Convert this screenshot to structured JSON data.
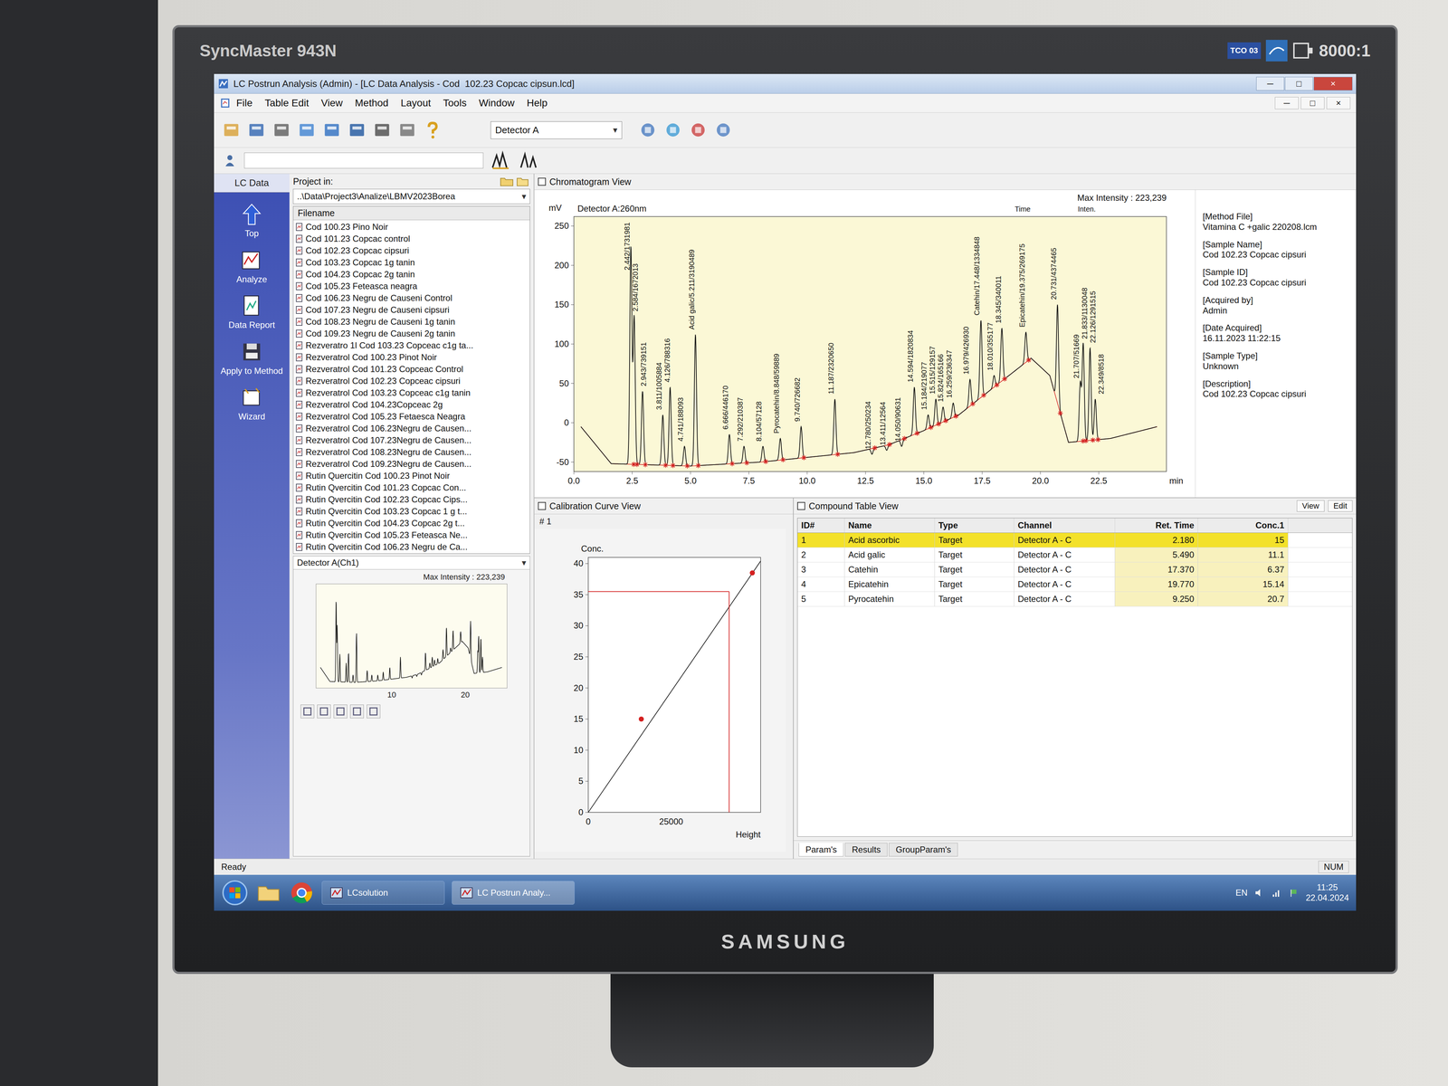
{
  "monitor": {
    "model": "SyncMaster 943N",
    "contrast": "8000:1",
    "badge": "TCO 03",
    "brand": "SAMSUNG"
  },
  "window": {
    "title": "LC Postrun Analysis (Admin) - [LC Data Analysis - Cod  102.23 Copcac cipsun.lcd]",
    "buttons": [
      "─",
      "□",
      "×"
    ]
  },
  "menu": [
    "File",
    "Table Edit",
    "View",
    "Method",
    "Layout",
    "Tools",
    "Window",
    "Help"
  ],
  "mdi_buttons": [
    "─",
    "□",
    "×"
  ],
  "toolbar": {
    "detector": "Detector A",
    "dropdown_arrow": "▾",
    "field_value": ""
  },
  "nav": {
    "header": "LC Data",
    "items": [
      {
        "label": "Top"
      },
      {
        "label": "Analyze"
      },
      {
        "label": "Data Report"
      },
      {
        "label": "Apply to Method"
      },
      {
        "label": "Wizard"
      }
    ]
  },
  "project": {
    "label": "Project in:",
    "path": "..\\Data\\Project3\\Analize\\LBMV2023Borea",
    "column": "Filename",
    "files": [
      "Cod 100.23 Pino Noir",
      "Cod 101.23 Copcac control",
      "Cod 102.23 Copcac cipsuri",
      "Cod 103.23 Copcac 1g tanin",
      "Cod 104.23 Copcac 2g tanin",
      "Cod 105.23 Feteasca neagra",
      "Cod 106.23 Negru de Causeni Control",
      "Cod 107.23 Negru de Causeni cipsuri",
      "Cod 108.23 Negru de Causeni 1g tanin",
      "Cod 109.23 Negru de Causeni 2g tanin",
      "Rezveratro 1l Cod 103.23 Copceac c1g ta...",
      "Rezveratrol Cod 100.23 Pinot Noir",
      "Rezveratrol Cod 101.23 Copceac Control",
      "Rezveratrol Cod 102.23 Copceac cipsuri",
      "Rezveratrol Cod 103.23 Copceac c1g tanin",
      "Rezveratrol Cod 104.23Copceac 2g",
      "Rezveratrol Cod 105.23 Fetaesca Neagra",
      "Rezveratrol Cod 106.23Negru de Causen...",
      "Rezveratrol Cod 107.23Negru de Causen...",
      "Rezveratrol Cod 108.23Negru de Causen...",
      "Rezveratrol Cod 109.23Negru de Causen...",
      "Rutin Quercitin Cod 100.23 Pinot Noir",
      "Rutin Qvercitin Cod 101.23 Copcac Con...",
      "Rutin Qvercitin Cod 102.23 Copcac Cips...",
      "Rutin Qvercitin Cod 103.23 Copcac 1 g t...",
      "Rutin Qvercitin Cod 104.23 Copcac 2g t...",
      "Rutin Qvercitin Cod 105.23 Feteasca Ne...",
      "Rutin Qvercitin Cod 106.23 Negru de Ca..."
    ]
  },
  "preview": {
    "title": "Detector A(Ch1)",
    "max_intensity": "Max Intensity : 223,239",
    "x_ticks": [
      "10",
      "20"
    ]
  },
  "chromatogram": {
    "title": "Chromatogram View",
    "detector": "Detector A:260nm",
    "unit": "mV",
    "max_intensity": "Max Intensity : 223,239",
    "time_label": "Time",
    "inten_label": "Inten.",
    "x_unit": "min",
    "y_ticks": [
      "250",
      "200",
      "150",
      "100",
      "50",
      "0",
      "-50"
    ],
    "x_ticks": [
      "0.0",
      "2.5",
      "5.0",
      "7.5",
      "10.0",
      "12.5",
      "15.0",
      "17.5",
      "20.0",
      "22.5"
    ],
    "baseline": [
      {
        "time": 0.3,
        "mV": -5
      },
      {
        "time": 1.6,
        "mV": -52
      },
      {
        "time": 5.0,
        "mV": -55
      },
      {
        "time": 8.0,
        "mV": -50
      },
      {
        "time": 10.0,
        "mV": -44
      },
      {
        "time": 12.0,
        "mV": -38
      },
      {
        "time": 13.5,
        "mV": -28
      },
      {
        "time": 15.0,
        "mV": -10
      },
      {
        "time": 16.5,
        "mV": 10
      },
      {
        "time": 18.0,
        "mV": 45
      },
      {
        "time": 19.6,
        "mV": 82
      },
      {
        "time": 20.4,
        "mV": 60
      },
      {
        "time": 21.2,
        "mV": -25
      },
      {
        "time": 23.0,
        "mV": -20
      },
      {
        "time": 25.0,
        "mV": -5
      }
    ],
    "peaks": [
      {
        "time": 2.442,
        "apex": 223,
        "label": "2.442/1731981"
      },
      {
        "time": 2.584,
        "apex": 135,
        "label": "2.584/1672013"
      },
      {
        "time": 2.943,
        "apex": 40,
        "label": "2.943/739151"
      },
      {
        "time": 3.811,
        "apex": 10,
        "label": "3.811/1005884"
      },
      {
        "time": 4.126,
        "apex": 45,
        "label": "4.126/788316"
      },
      {
        "time": 4.741,
        "apex": -30,
        "label": "4.741/188093"
      },
      {
        "time": 5.211,
        "apex": 112,
        "label": "Acid galic/5.211/3190489"
      },
      {
        "time": 6.666,
        "apex": -15,
        "label": "6.666/446170"
      },
      {
        "time": 7.292,
        "apex": -30,
        "label": "7.292/210387"
      },
      {
        "time": 8.104,
        "apex": -30,
        "label": "8.104/57128"
      },
      {
        "time": 8.848,
        "apex": -20,
        "label": "Pyrocatehin/8.848/59889"
      },
      {
        "time": 9.74,
        "apex": -5,
        "label": "9.740/726682"
      },
      {
        "time": 11.187,
        "apex": 30,
        "label": "11.187/2320650"
      },
      {
        "time": 12.78,
        "apex": -40,
        "label": "12.780/250234"
      },
      {
        "time": 13.411,
        "apex": -35,
        "label": "13.411/12564"
      },
      {
        "time": 14.05,
        "apex": -30,
        "label": "14.050/90631"
      },
      {
        "time": 14.594,
        "apex": 45,
        "label": "14.594/1820834"
      },
      {
        "time": 15.184,
        "apex": 10,
        "label": "15.184/219077"
      },
      {
        "time": 15.515,
        "apex": 30,
        "label": "15.515/129157"
      },
      {
        "time": 15.824,
        "apex": 20,
        "label": "15.824/165166"
      },
      {
        "time": 16.259,
        "apex": 25,
        "label": "16.259/236347"
      },
      {
        "time": 16.979,
        "apex": 55,
        "label": "16.979/426930"
      },
      {
        "time": 17.448,
        "apex": 130,
        "label": "Catehin/17.448/1334848"
      },
      {
        "time": 18.01,
        "apex": 60,
        "label": "18.010/355177"
      },
      {
        "time": 18.345,
        "apex": 120,
        "label": "18.345/340011"
      },
      {
        "time": 19.375,
        "apex": 115,
        "label": "Epicatehin/19.375/269175"
      },
      {
        "time": 20.731,
        "apex": 150,
        "label": "20.731/4374465"
      },
      {
        "time": 21.707,
        "apex": 50,
        "label": "21.707/51669"
      },
      {
        "time": 21.833,
        "apex": 100,
        "label": "21.833/1130048"
      },
      {
        "time": 22.126,
        "apex": 95,
        "label": "22.126/1291515"
      },
      {
        "time": 22.349,
        "apex": 30,
        "label": "22.349/8518"
      }
    ]
  },
  "sample_info": [
    {
      "label": "[Method File]",
      "value": "Vitamina C +galic 220208.lcm"
    },
    {
      "label": "[Sample Name]",
      "value": "Cod 102.23 Copcac cipsuri"
    },
    {
      "label": "[Sample ID]",
      "value": "Cod 102.23 Copcac cipsuri"
    },
    {
      "label": "[Acquired by]",
      "value": "Admin"
    },
    {
      "label": "[Date Acquired]",
      "value": "16.11.2023 11:22:15"
    },
    {
      "label": "[Sample Type]",
      "value": "Unknown"
    },
    {
      "label": "[Description]",
      "value": "Cod 102.23 Copcac cipsuri"
    }
  ],
  "calibration": {
    "title": "Calibration Curve View",
    "index": "# 1",
    "y_label": "Conc.",
    "x_label": "Height",
    "y_ticks": [
      "40",
      "35",
      "30",
      "25",
      "20",
      "15",
      "10",
      "5",
      "0"
    ],
    "x_ticks": [
      "0",
      "25000"
    ],
    "slope": 0.000777,
    "points": [
      {
        "height": 16000,
        "conc": 15
      },
      {
        "height": 49500,
        "conc": 38.5
      }
    ],
    "marker": {
      "height": 42500,
      "conc": 35.5
    }
  },
  "compound_table": {
    "title": "Compound Table View",
    "view_button": "View",
    "edit_button": "Edit",
    "columns": [
      "ID#",
      "Name",
      "Type",
      "Channel",
      "Ret. Time",
      "Conc.1"
    ],
    "rows": [
      {
        "cells": [
          "1",
          "Acid ascorbic",
          "Target",
          "Detector A - C",
          "2.180",
          "15"
        ],
        "selected": true
      },
      {
        "cells": [
          "2",
          "Acid galic",
          "Target",
          "Detector A - C",
          "5.490",
          "11.1"
        ],
        "selected": false
      },
      {
        "cells": [
          "3",
          "Catehin",
          "Target",
          "Detector A - C",
          "17.370",
          "6.37"
        ],
        "selected": false
      },
      {
        "cells": [
          "4",
          "Epicatehin",
          "Target",
          "Detector A - C",
          "19.770",
          "15.14"
        ],
        "selected": false
      },
      {
        "cells": [
          "5",
          "Pyrocatehin",
          "Target",
          "Detector A - C",
          "9.250",
          "20.7"
        ],
        "selected": false
      }
    ],
    "tabs": [
      {
        "label": "Param's",
        "selected": true
      },
      {
        "label": "Results",
        "selected": false
      },
      {
        "label": "GroupParam's",
        "selected": false
      }
    ]
  },
  "status": {
    "left": "Ready",
    "right": "NUM"
  },
  "taskbar": {
    "apps": [
      {
        "label": "LCsolution",
        "selected": false
      },
      {
        "label": "LC Postrun Analy...",
        "selected": true
      }
    ],
    "language": "EN",
    "time": "11:25",
    "date": "22.04.2024"
  }
}
